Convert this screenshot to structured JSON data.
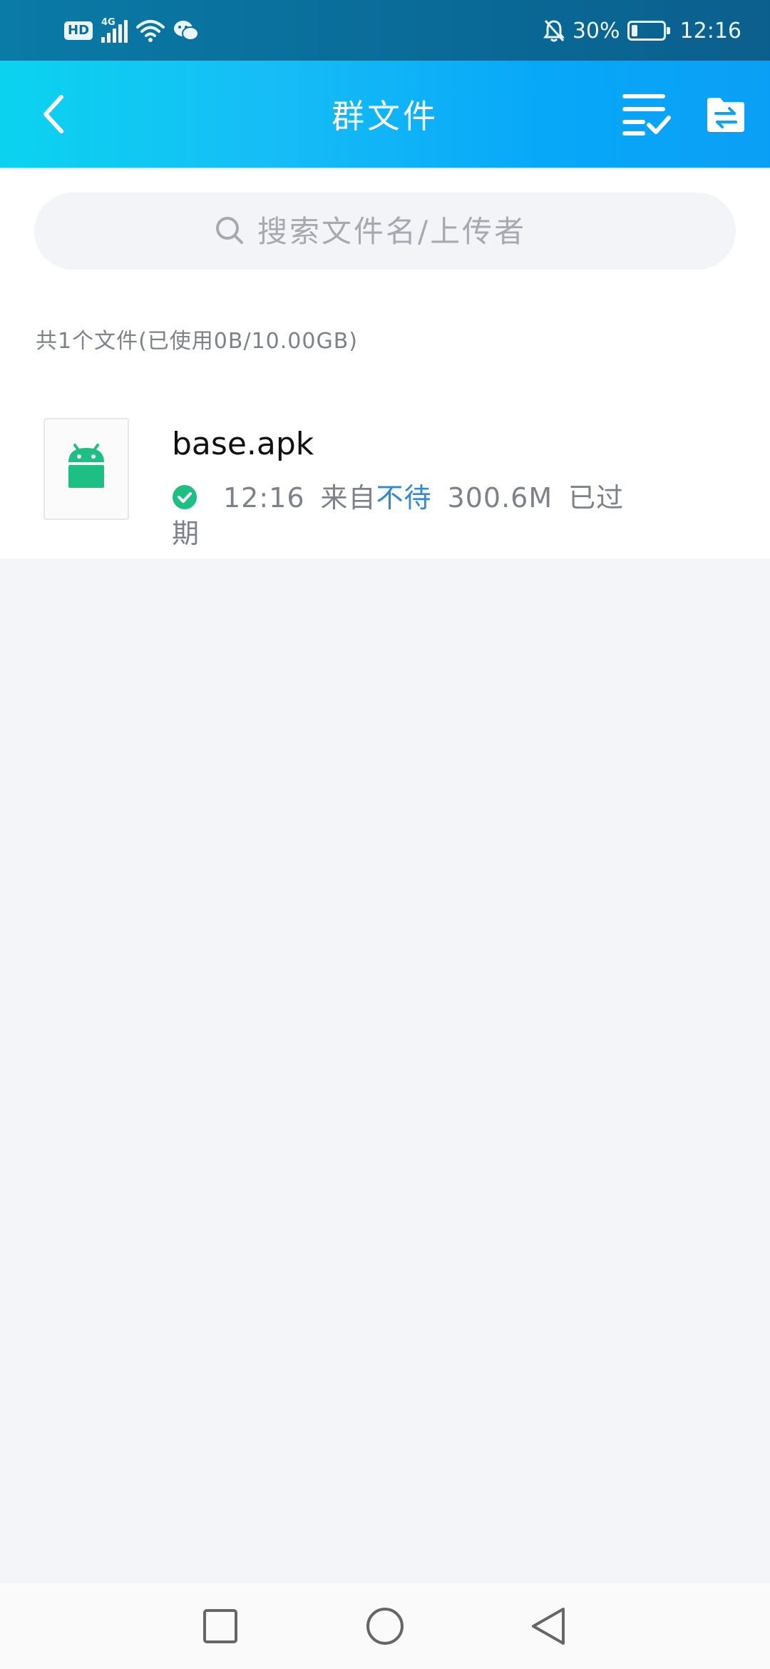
{
  "status_bar": {
    "hd_label": "HD",
    "network_label": "4G",
    "battery_text": "30%",
    "battery_level": 0.3,
    "time": "12:16",
    "icons": [
      "hd-icon",
      "signal-icon",
      "wifi-icon",
      "wechat-icon",
      "mute-bell-icon",
      "battery-icon"
    ]
  },
  "header": {
    "title": "群文件",
    "icons": [
      "back-arrow-icon",
      "multi-select-icon",
      "folder-transfer-icon"
    ]
  },
  "search": {
    "placeholder": "搜索文件名/上传者"
  },
  "summary": "共1个文件(已使用0B/10.00GB)",
  "files": [
    {
      "name": "base.apk",
      "icon": "android-icon",
      "status_icon": "check-circle-icon",
      "time": "12:16",
      "from_label": "来自",
      "uploader": "不待",
      "size": "300.6M",
      "status": "已过期"
    }
  ],
  "colors": {
    "header_gradient_start": "#0bd3ef",
    "header_gradient_end": "#0a9ff6",
    "status_bar": "#0a6f9c",
    "accent_link": "#2e8ad8",
    "android_green": "#1dbf85",
    "background": "#f3f5f8"
  },
  "nav_bar": {
    "icons": [
      "recents-square-icon",
      "home-circle-icon",
      "back-triangle-icon"
    ]
  }
}
